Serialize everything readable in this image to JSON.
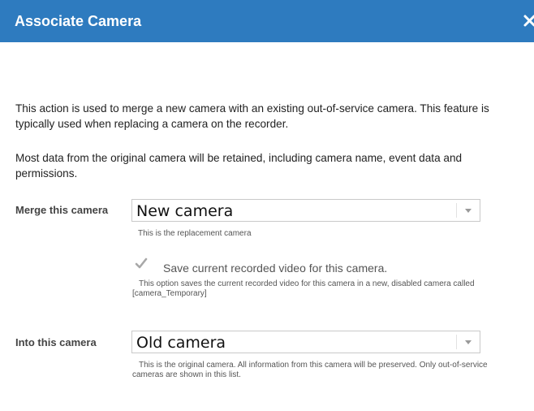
{
  "dialog": {
    "title": "Associate Camera",
    "close_icon": "close-icon",
    "accent_color": "#2e7bbf"
  },
  "intro": {
    "paragraph1": "This action is used to merge a new camera with an existing out-of-service camera. This feature is typically used when replacing a camera on the recorder.",
    "paragraph2": "Most data from the original camera will be retained, including camera name, event data and permissions."
  },
  "merge": {
    "label": "Merge this camera",
    "selected": "New camera",
    "hint": "This is the replacement camera"
  },
  "save_video": {
    "checked": true,
    "label": "Save current recorded video for this camera.",
    "hint": "This option saves the current recorded video for this camera in a new, disabled camera called [camera_Temporary]"
  },
  "into": {
    "label": "Into this camera",
    "selected": "Old camera",
    "hint": "This is the original camera. All information from this camera will be preserved. Only out-of-service cameras are shown in this list."
  }
}
